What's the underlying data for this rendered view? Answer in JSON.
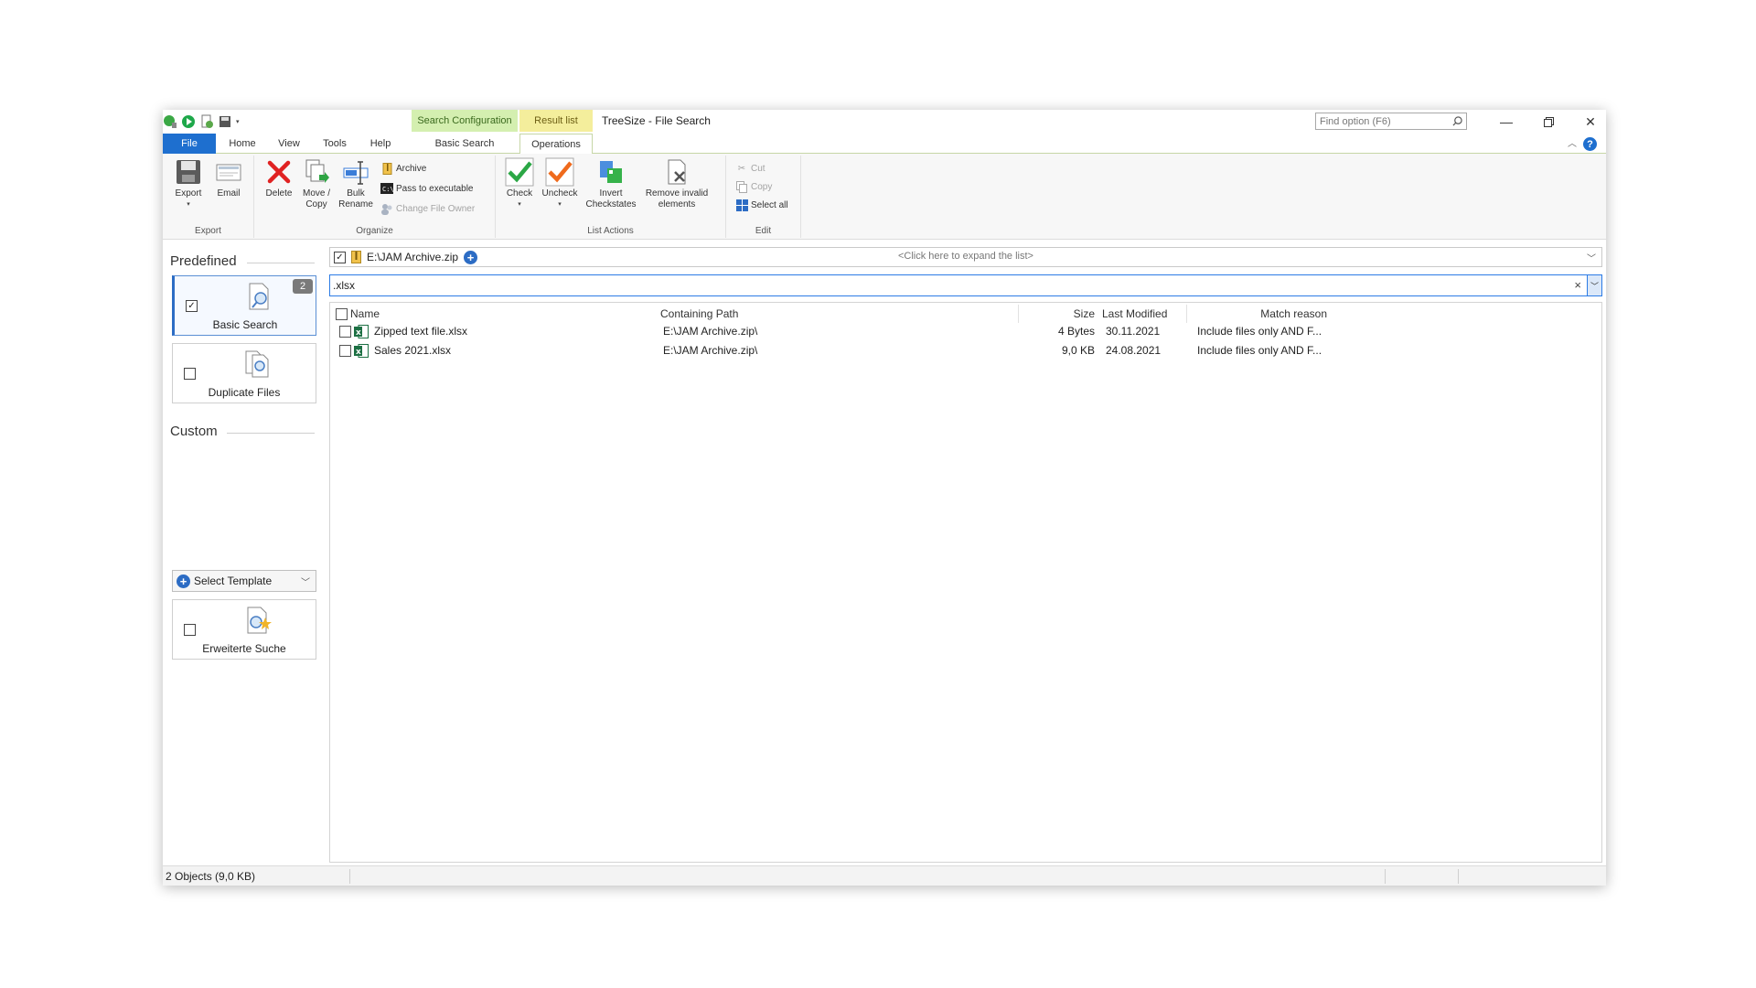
{
  "app_title": "TreeSize - File Search",
  "context_tabs": {
    "search_config": "Search Configuration",
    "result_list": "Result list"
  },
  "tabs": {
    "file": "File",
    "home": "Home",
    "view": "View",
    "tools": "Tools",
    "help": "Help",
    "basic_search": "Basic Search",
    "operations": "Operations"
  },
  "find_option_placeholder": "Find option (F6)",
  "ribbon": {
    "export_group": {
      "label": "Export",
      "export": "Export",
      "email": "Email"
    },
    "organize_group": {
      "label": "Organize",
      "delete": "Delete",
      "move_copy_1": "Move /",
      "move_copy_2": "Copy",
      "bulk_rename_1": "Bulk",
      "bulk_rename_2": "Rename",
      "archive": "Archive",
      "pass_to_executable": "Pass to executable",
      "change_file_owner": "Change File Owner"
    },
    "list_actions_group": {
      "label": "List Actions",
      "check": "Check",
      "uncheck": "Uncheck",
      "invert_1": "Invert",
      "invert_2": "Checkstates",
      "remove_1": "Remove invalid",
      "remove_2": "elements"
    },
    "edit_group": {
      "label": "Edit",
      "cut": "Cut",
      "copy": "Copy",
      "select_all": "Select all"
    }
  },
  "sidebar": {
    "predefined_title": "Predefined",
    "basic_search": {
      "label": "Basic Search",
      "badge": "2",
      "checked": "✓"
    },
    "duplicate_files": {
      "label": "Duplicate Files"
    },
    "custom_title": "Custom",
    "select_template": "Select Template",
    "custom_search": {
      "label": "Erweiterte Suche"
    }
  },
  "path_bar": {
    "checked": "✓",
    "path": "E:\\JAM Archive.zip",
    "expand_hint": "<Click here to expand the list>"
  },
  "filter": {
    "value": ".xlsx"
  },
  "table": {
    "headers": {
      "name": "Name",
      "path": "Containing Path",
      "size": "Size",
      "modified": "Last Modified",
      "reason": "Match reason"
    },
    "rows": [
      {
        "name": "Zipped text file.xlsx",
        "path": "E:\\JAM Archive.zip\\",
        "size": "4 Bytes",
        "modified": "30.11.2021",
        "reason": "Include files only AND F..."
      },
      {
        "name": "Sales 2021.xlsx",
        "path": "E:\\JAM Archive.zip\\",
        "size": "9,0 KB",
        "modified": "24.08.2021",
        "reason": "Include files only AND F..."
      }
    ]
  },
  "status": {
    "objects": "2 Objects (9,0 KB)"
  },
  "colors": {
    "file_tab": "#1e6fcf",
    "search_config_ctx": "#d4efb0",
    "result_list_ctx": "#f4ee9c",
    "accent": "#2c7be5"
  },
  "icons": {
    "quick_access": [
      "treesize-logo-icon",
      "start-scan-icon",
      "new-icon",
      "save-icon"
    ],
    "ribbon": [
      "export-icon",
      "email-icon",
      "delete-icon",
      "move-copy-icon",
      "bulk-rename-icon",
      "archive-icon",
      "console-icon",
      "change-owner-icon",
      "check-icon",
      "uncheck-icon",
      "invert-checkstates-icon",
      "remove-invalid-icon",
      "cut-icon",
      "copy-icon",
      "select-all-icon"
    ],
    "sidebar": [
      "basic-search-icon",
      "duplicate-files-icon",
      "custom-search-icon",
      "add-circle-icon"
    ],
    "window": [
      "minimize-icon",
      "restore-icon",
      "close-icon",
      "search-icon",
      "help-icon",
      "collapse-ribbon-icon"
    ]
  }
}
